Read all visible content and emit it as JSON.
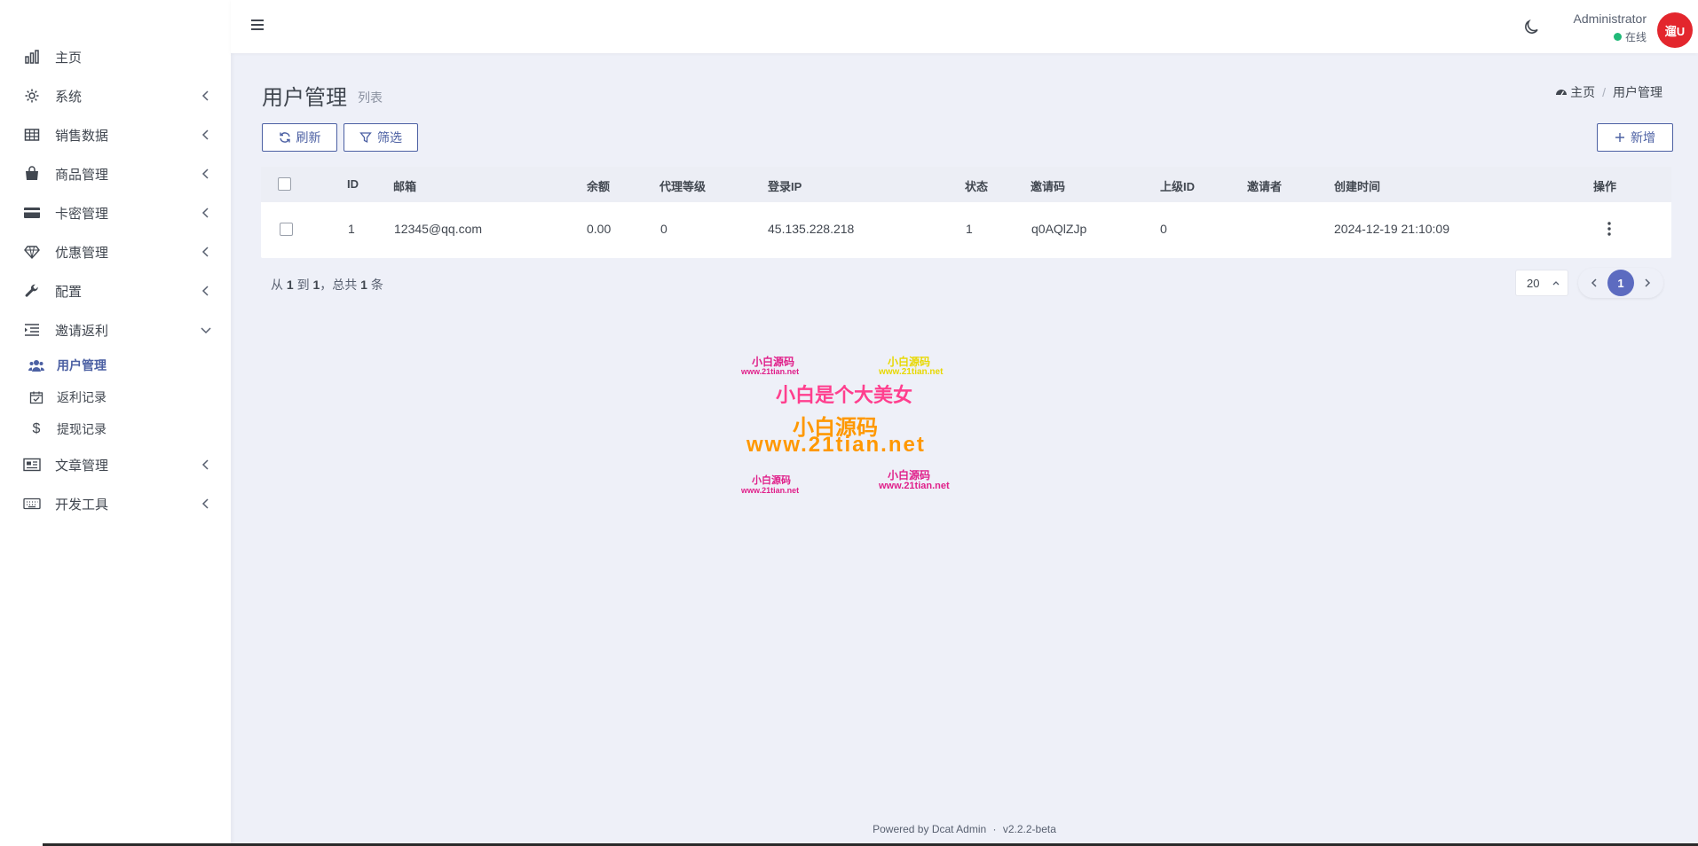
{
  "sidebar": {
    "items": [
      {
        "label": "主页",
        "icon": "bar-chart-icon",
        "arrow": ""
      },
      {
        "label": "系统",
        "icon": "gear-icon",
        "arrow": "left"
      },
      {
        "label": "销售数据",
        "icon": "table-icon",
        "arrow": "left"
      },
      {
        "label": "商品管理",
        "icon": "shopping-bag-icon",
        "arrow": "left"
      },
      {
        "label": "卡密管理",
        "icon": "credit-card-icon",
        "arrow": "left"
      },
      {
        "label": "优惠管理",
        "icon": "diamond-icon",
        "arrow": "left"
      },
      {
        "label": "配置",
        "icon": "wrench-icon",
        "arrow": "left"
      },
      {
        "label": "邀请返利",
        "icon": "indent-icon",
        "arrow": "down"
      }
    ],
    "sub_items": [
      {
        "label": "用户管理",
        "icon": "users-icon",
        "active": true
      },
      {
        "label": "返利记录",
        "icon": "calendar-check-icon",
        "active": false
      },
      {
        "label": "提现记录",
        "icon": "dollar-icon",
        "active": false
      }
    ],
    "items_after": [
      {
        "label": "文章管理",
        "icon": "newspaper-icon",
        "arrow": "left"
      },
      {
        "label": "开发工具",
        "icon": "keyboard-icon",
        "arrow": "left"
      }
    ]
  },
  "header": {
    "user_name": "Administrator",
    "user_status": "在线",
    "avatar_text": "遛U",
    "avatar_color": "#e3262d",
    "status_color": "#21b978"
  },
  "page": {
    "title": "用户管理",
    "subtitle": "列表",
    "breadcrumb_home": "主页",
    "breadcrumb_current": "用户管理"
  },
  "toolbar": {
    "refresh_label": "刷新",
    "filter_label": "筛选",
    "create_label": "新增"
  },
  "table": {
    "columns": [
      "ID",
      "邮箱",
      "余额",
      "代理等级",
      "登录IP",
      "状态",
      "邀请码",
      "上级ID",
      "邀请者",
      "创建时间",
      "操作"
    ],
    "rows": [
      {
        "id": "1",
        "email": "12345@qq.com",
        "balance": "0.00",
        "level": "0",
        "ip": "45.135.228.218",
        "status": "1",
        "invite_code": "q0AQlZJp",
        "parent_id": "0",
        "inviter": "",
        "created_at": "2024-12-19 21:10:09"
      }
    ]
  },
  "pagination": {
    "summary_prefix": "从",
    "from": "1",
    "to_word": "到",
    "to": "1",
    "total_word": "，总共",
    "total": "1",
    "unit": "条",
    "per_page": "20",
    "current_page": "1",
    "accent": "#5c6bc0"
  },
  "watermark": {
    "small_pink": "小白源码",
    "small_url": "www.21tian.net",
    "small_yellow": "小白源码",
    "slogan": "小白是个大美女",
    "big_title": "小白源码",
    "big_url": "www.21tian.net"
  },
  "footer": {
    "powered": "Powered by",
    "brand": "Dcat Admin",
    "sep": "·",
    "version": "v2.2.2-beta"
  },
  "colors": {
    "primary": "#4c60a3",
    "background": "#eef0f8"
  }
}
